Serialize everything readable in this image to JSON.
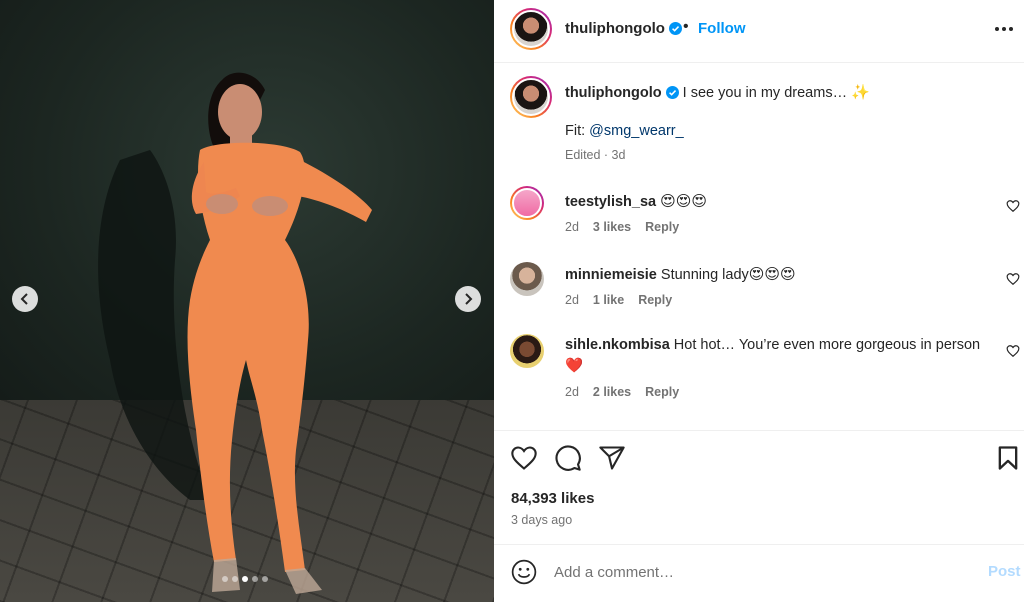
{
  "post": {
    "author": "thuliphongolo",
    "follow_label": "Follow",
    "dot": "•",
    "caption": {
      "username": "thuliphongolo",
      "text": "I see you in my dreams…",
      "emoji": "✨",
      "fit_label": "Fit:",
      "fit_mention": "@smg_wearr_",
      "edited": "Edited · 3d"
    },
    "media": {
      "slide_count": 5,
      "active_slide": 2
    }
  },
  "comments": [
    {
      "username": "teestylish_sa",
      "text": "",
      "emoji": "😍😍😍",
      "age": "2d",
      "likes": "3 likes",
      "reply": "Reply"
    },
    {
      "username": "minniemeisie",
      "text": "Stunning lady",
      "emoji": "😍😍😍",
      "age": "2d",
      "likes": "1 like",
      "reply": "Reply"
    },
    {
      "username": "sihle.nkombisa",
      "text": "Hot hot… You’re even more gorgeous in person",
      "emoji": "❤️",
      "age": "2d",
      "likes": "2 likes",
      "reply": "Reply"
    }
  ],
  "stats": {
    "likes": "84,393 likes",
    "age": "3 days ago"
  },
  "comment_box": {
    "placeholder": "Add a comment…",
    "post_label": "Post"
  },
  "colors": {
    "accent": "#0095f6",
    "verified": "#0095f6",
    "post_disabled": "#b3dbff",
    "heart_red": "#ed1c24"
  },
  "icons": {
    "like": "heart-icon",
    "comment": "comment-bubble-icon",
    "share": "paper-plane-icon",
    "save": "bookmark-icon",
    "emoji": "smiley-icon",
    "more": "more-options-icon",
    "prev": "chevron-left-icon",
    "next": "chevron-right-icon"
  }
}
